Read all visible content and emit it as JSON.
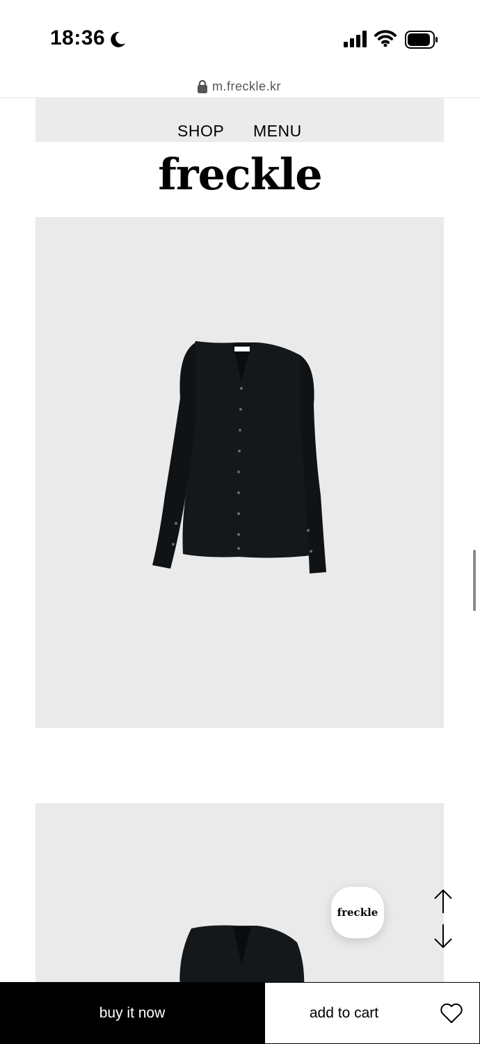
{
  "status_bar": {
    "time": "18:36",
    "icons": [
      "moon-icon",
      "signal-icon",
      "wifi-icon",
      "battery-icon"
    ]
  },
  "browser": {
    "url": "m.freckle.kr",
    "lock_icon": "lock-icon"
  },
  "nav": {
    "shop_label": "SHOP",
    "menu_label": "MENU"
  },
  "brand": {
    "logo_text": "freckle",
    "floating_logo_text": "freckle"
  },
  "product": {
    "images": [
      "black cardigan front",
      "black cardigan front"
    ],
    "image_background": "#eaeaea"
  },
  "actions": {
    "buy_now_label": "buy it now",
    "add_to_cart_label": "add to cart",
    "wishlist_icon": "heart-icon",
    "scroll_up_icon": "arrow-up-icon",
    "scroll_down_icon": "arrow-down-icon"
  },
  "colors": {
    "primary": "#000000",
    "background": "#ffffff",
    "panel": "#ebebeb"
  }
}
